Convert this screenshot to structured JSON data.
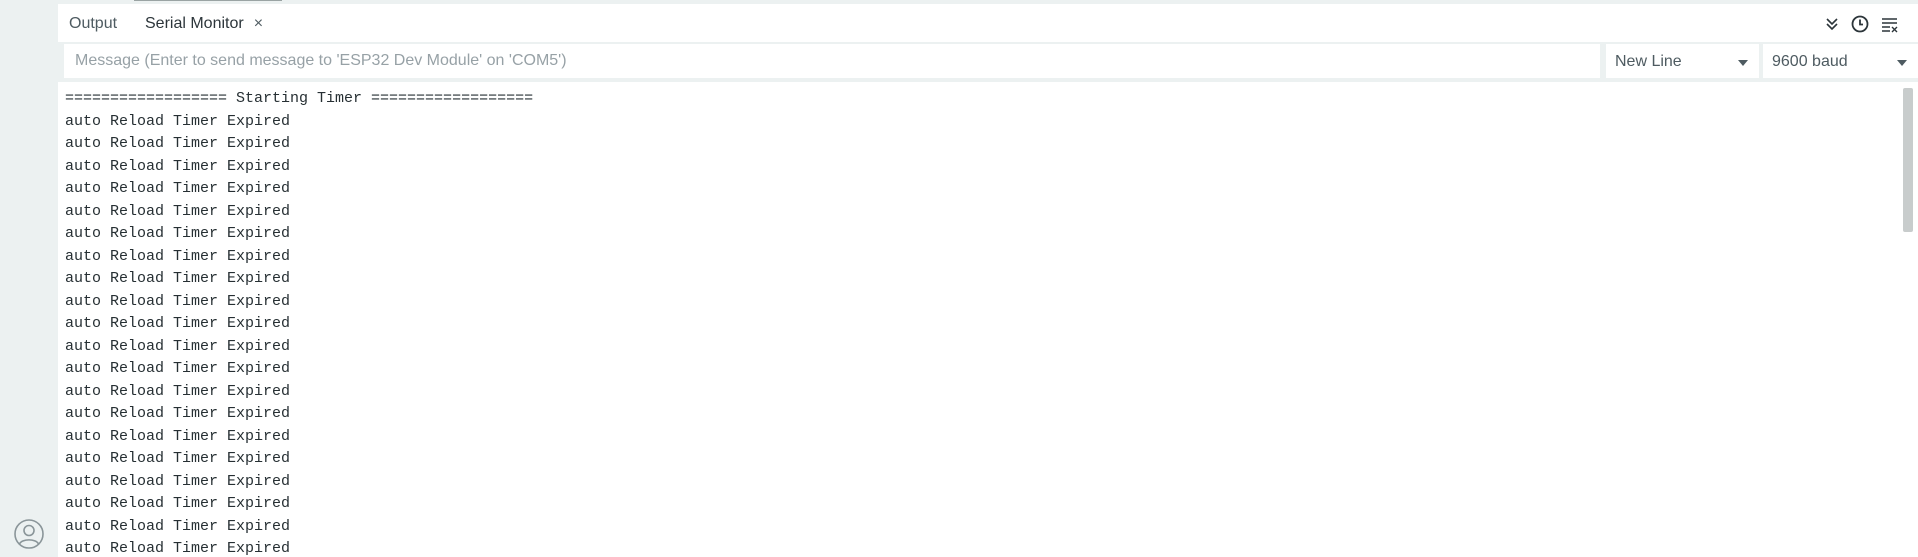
{
  "tabs": [
    {
      "label": "Output"
    },
    {
      "label": "Serial Monitor",
      "close": "×"
    }
  ],
  "toolbar": {
    "icons": [
      "toggle-autoscroll-icon",
      "timestamp-clock-icon",
      "clear-output-icon"
    ]
  },
  "message": {
    "placeholder": "Message (Enter to send message to 'ESP32 Dev Module' on 'COM5')",
    "value": ""
  },
  "line_ending": {
    "selected": "New Line"
  },
  "baud_rate": {
    "selected": "9600 baud"
  },
  "log": [
    "================== Starting Timer ==================",
    "auto Reload Timer Expired",
    "auto Reload Timer Expired",
    "auto Reload Timer Expired",
    "auto Reload Timer Expired",
    "auto Reload Timer Expired",
    "auto Reload Timer Expired",
    "auto Reload Timer Expired",
    "auto Reload Timer Expired",
    "auto Reload Timer Expired",
    "auto Reload Timer Expired",
    "auto Reload Timer Expired",
    "auto Reload Timer Expired",
    "auto Reload Timer Expired",
    "auto Reload Timer Expired",
    "auto Reload Timer Expired",
    "auto Reload Timer Expired",
    "auto Reload Timer Expired",
    "auto Reload Timer Expired",
    "auto Reload Timer Expired",
    "auto Reload Timer Expired"
  ],
  "colors": {
    "background": "#ecf1f1",
    "panel": "#ffffff",
    "text": "#262f33",
    "muted": "#4e5b61",
    "scroll_thumb": "#c8cccc"
  }
}
